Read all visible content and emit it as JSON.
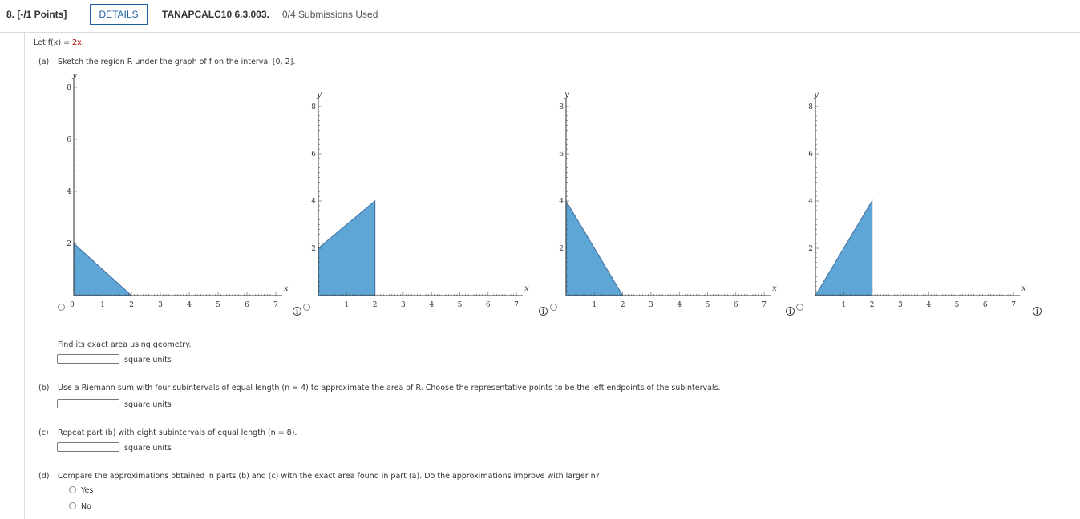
{
  "header": {
    "question_number": "8.  [-/1 Points]",
    "details_label": "DETAILS",
    "problem_code": "TANAPCALC10 6.3.003.",
    "submissions": "0/4 Submissions Used"
  },
  "problem": {
    "let_prefix": "Let f(x) = ",
    "let_expr": "2x",
    "let_suffix": "."
  },
  "part_a": {
    "marker": "(a)",
    "text": "Sketch the region R under the graph of f on the interval [0, 2].",
    "find_text": "Find its exact area using geometry.",
    "units": "square units"
  },
  "part_b": {
    "marker": "(b)",
    "text": "Use a Riemann sum with four subintervals of equal length (n = 4) to approximate the area of R. Choose the representative points to be the left endpoints of the subintervals.",
    "units": "square units"
  },
  "part_c": {
    "marker": "(c)",
    "text": "Repeat part (b) with eight subintervals of equal length (n = 8).",
    "units": "square units"
  },
  "part_d": {
    "marker": "(d)",
    "text": "Compare the approximations obtained in parts (b) and (c) with the exact area found in part (a). Do the approximations improve with larger n?",
    "options": [
      "Yes",
      "No"
    ]
  },
  "info_icon": "info-icon",
  "graph_axes": {
    "x_label": "x",
    "y_label": "y",
    "x_ticks": [
      "1",
      "2",
      "3",
      "4",
      "5",
      "6",
      "7"
    ],
    "y_ticks": [
      "2",
      "4",
      "6",
      "8"
    ],
    "x_range": [
      0,
      7
    ],
    "y_range": [
      0,
      8
    ]
  },
  "chart_data": [
    {
      "type": "area",
      "x": [
        0,
        2
      ],
      "y": [
        2,
        0
      ],
      "origin_label": "0",
      "fill": "#5ea6d6"
    },
    {
      "type": "area",
      "x": [
        0,
        2
      ],
      "y": [
        2,
        4
      ],
      "fill": "#5ea6d6"
    },
    {
      "type": "area",
      "x": [
        0,
        2
      ],
      "y": [
        4,
        0
      ],
      "fill": "#5ea6d6"
    },
    {
      "type": "area",
      "x": [
        0,
        2
      ],
      "y": [
        0,
        4
      ],
      "fill": "#5ea6d6"
    }
  ]
}
